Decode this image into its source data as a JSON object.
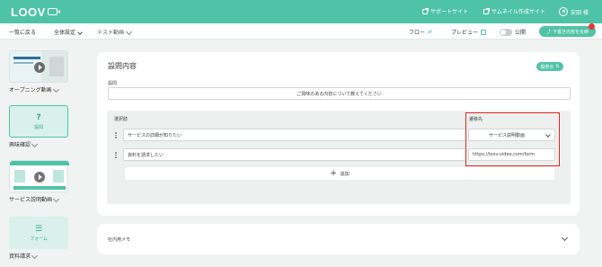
{
  "brand": {
    "logo_text": "LOOV",
    "accent": "#4fc3a8"
  },
  "topbar": {
    "support_link": "サポートサイト",
    "thumbnail_link": "サムネイル作成サイト",
    "user_name": "安田 様"
  },
  "toolbar": {
    "back": "一覧に戻る",
    "global_settings": "全体設定",
    "video_title": "テスト動画",
    "flow": "フロー",
    "preview": "プレビュー",
    "publish_label": "公開",
    "save_draft": "下書き内容を反映"
  },
  "sidebar": {
    "items": [
      {
        "label": "オープニング動画"
      },
      {
        "label": "興味確認",
        "thumb_text": "設問",
        "thumb_icon": "question-icon"
      },
      {
        "label": "サービス説明動画"
      },
      {
        "label": "資料請求",
        "thumb_text": "フォーム",
        "thumb_icon": "list-icon"
      }
    ]
  },
  "main": {
    "title": "設問内容",
    "display_toggle": "縦表示",
    "question_label": "設問",
    "question_value": "ご興味のある内容について教えてください",
    "choices_header": "選択肢",
    "destination_header": "遷移先",
    "choices": [
      {
        "text": "サービスの詳細が知りたい",
        "destination": "サービス説明動画"
      },
      {
        "text": "資料を請求したい",
        "destination": "https://loov-video.com/form"
      }
    ],
    "add_label": "追加"
  },
  "memo": {
    "label": "社内用メモ"
  }
}
